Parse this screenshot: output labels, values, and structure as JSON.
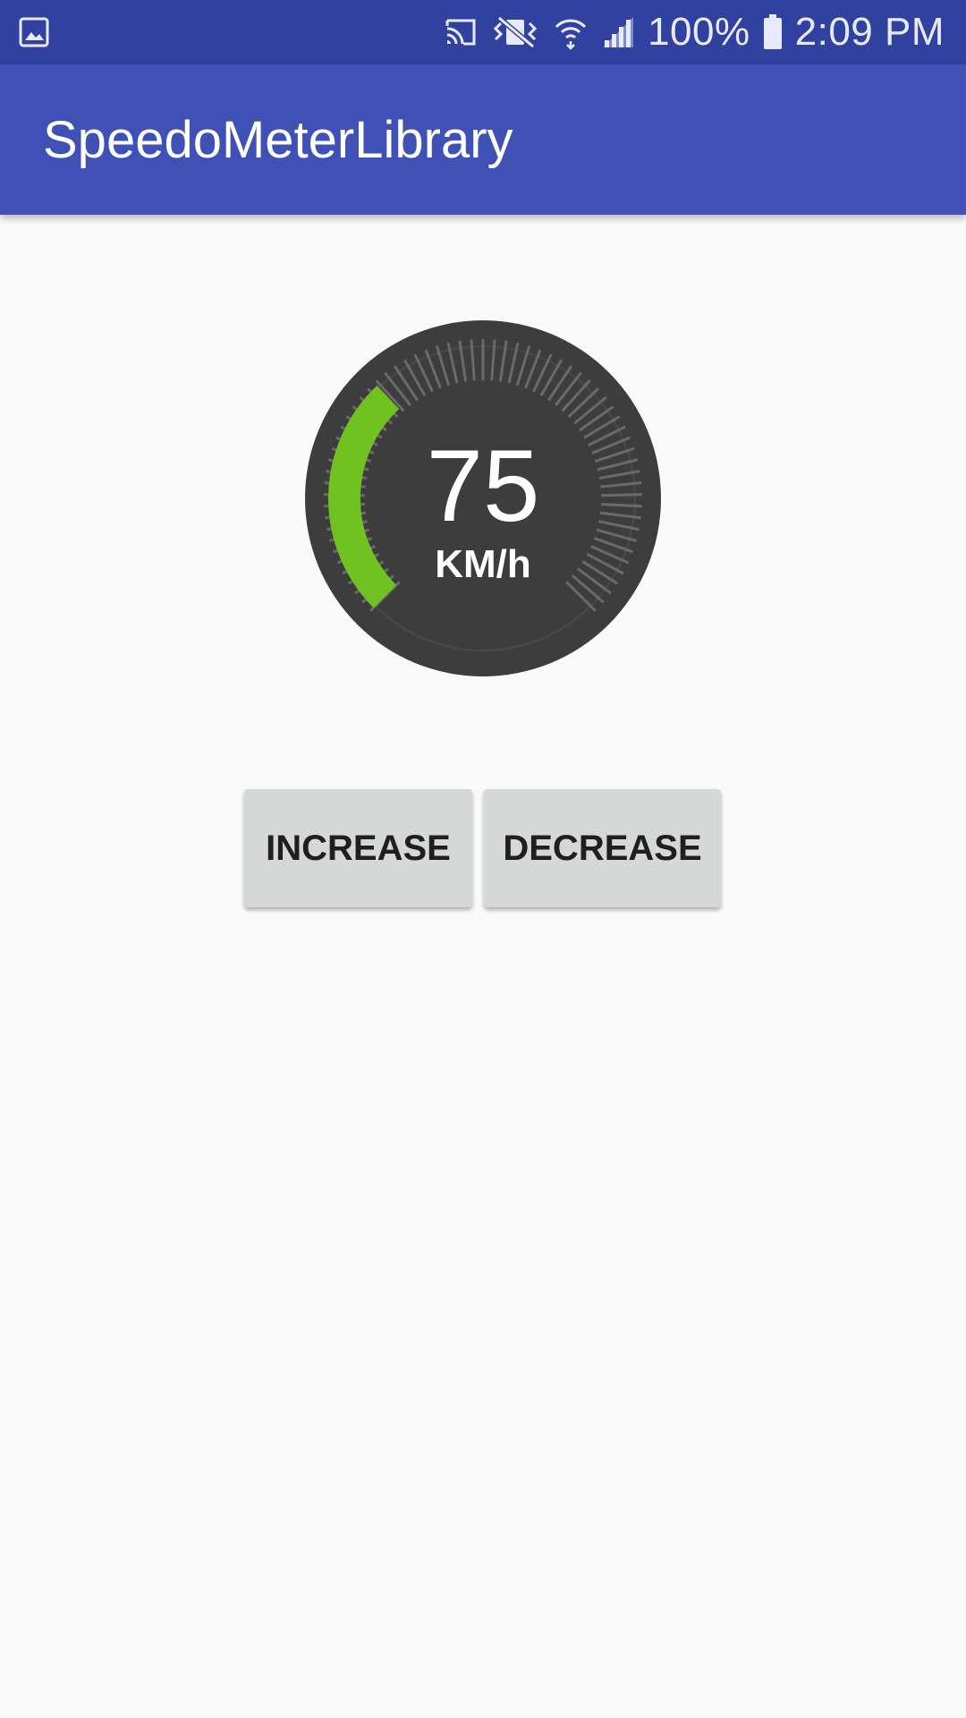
{
  "status_bar": {
    "left_icon": "gallery-icon",
    "icons": [
      "cast-icon",
      "vibrate-icon",
      "wifi-icon",
      "signal-icon"
    ],
    "battery_text": "100%",
    "battery_icon": "battery-icon",
    "time": "2:09 PM"
  },
  "app_bar": {
    "title": "SpeedoMeterLibrary",
    "color": "#3f51b5"
  },
  "speedometer": {
    "value": "75",
    "unit": "KM/h",
    "fill_fraction": 0.34,
    "accent_color": "#6fc21f",
    "dial_color": "#3d3d3d"
  },
  "buttons": {
    "increase_label": "INCREASE",
    "decrease_label": "DECREASE"
  }
}
